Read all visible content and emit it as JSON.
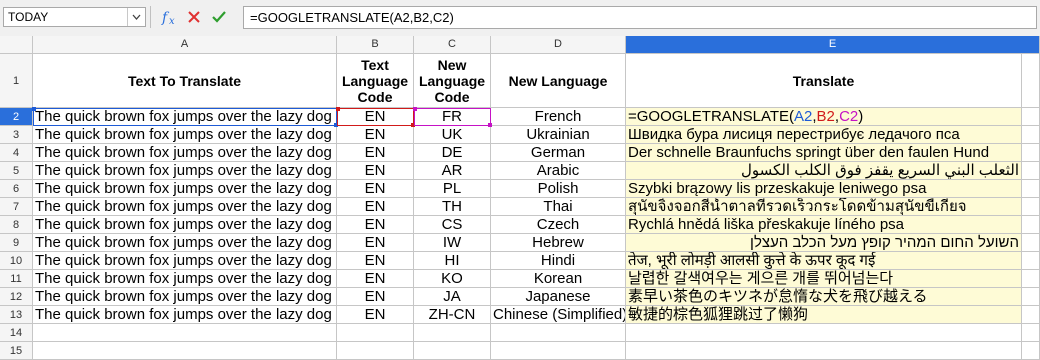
{
  "formula_bar": {
    "name_box_value": "TODAY",
    "formula_text": "=GOOGLETRANSLATE(A2,B2,C2)",
    "icons": [
      "function-wizard-icon",
      "cancel-icon",
      "accept-icon"
    ]
  },
  "columns": [
    "A",
    "B",
    "C",
    "D",
    "E"
  ],
  "header_row": {
    "A": "Text To Translate",
    "B": "Text Language Code",
    "C": "New Language Code",
    "D": "New Language",
    "E": "Translate"
  },
  "formula_cell": {
    "prefix": "=GOOGLETRANSLATE(",
    "arg1": "A2",
    "sep1": ",",
    "arg2": "B2",
    "sep2": ",",
    "arg3": "C2",
    "suffix": ")"
  },
  "rows": [
    {
      "num": "2",
      "A": "The quick brown fox jumps over the lazy dog",
      "B": "EN",
      "C": "FR",
      "D": "French",
      "E": ""
    },
    {
      "num": "3",
      "A": "The quick brown fox jumps over the lazy dog",
      "B": "EN",
      "C": "UK",
      "D": "Ukrainian",
      "E": "Швидка бура лисиця перестрибує ледачого пса"
    },
    {
      "num": "4",
      "A": "The quick brown fox jumps over the lazy dog",
      "B": "EN",
      "C": "DE",
      "D": "German",
      "E": "Der schnelle Braunfuchs springt über den faulen Hund"
    },
    {
      "num": "5",
      "A": "The quick brown fox jumps over the lazy dog",
      "B": "EN",
      "C": "AR",
      "D": "Arabic",
      "E": "الثعلب البني السريع يقفز فوق الكلب الكسول"
    },
    {
      "num": "6",
      "A": "The quick brown fox jumps over the lazy dog",
      "B": "EN",
      "C": "PL",
      "D": "Polish",
      "E": "Szybki brązowy lis przeskakuje leniwego psa"
    },
    {
      "num": "7",
      "A": "The quick brown fox jumps over the lazy dog",
      "B": "EN",
      "C": "TH",
      "D": "Thai",
      "E": "สุนัขจิ้งจอกสีน้ำตาลที่รวดเร็วกระโดดข้ามสุนัขขี้เกียจ"
    },
    {
      "num": "8",
      "A": "The quick brown fox jumps over the lazy dog",
      "B": "EN",
      "C": "CS",
      "D": "Czech",
      "E": "Rychlá hnědá liška přeskakuje líného psa"
    },
    {
      "num": "9",
      "A": "The quick brown fox jumps over the lazy dog",
      "B": "EN",
      "C": "IW",
      "D": "Hebrew",
      "E": "השועל החום המהיר קופץ מעל הכלב העצלן"
    },
    {
      "num": "10",
      "A": "The quick brown fox jumps over the lazy dog",
      "B": "EN",
      "C": "HI",
      "D": "Hindi",
      "E": "तेज, भूरी लोमड़ी आलसी कुत्ते के ऊपर कूद गई"
    },
    {
      "num": "11",
      "A": "The quick brown fox jumps over the lazy dog",
      "B": "EN",
      "C": "KO",
      "D": "Korean",
      "E": "날렵한 갈색여우는 게으른 개를 뛰어넘는다"
    },
    {
      "num": "12",
      "A": "The quick brown fox jumps over the lazy dog",
      "B": "EN",
      "C": "JA",
      "D": "Japanese",
      "E": "素早い茶色のキツネが怠惰な犬を飛び越える"
    },
    {
      "num": "13",
      "A": "The quick brown fox jumps over the lazy dog",
      "B": "EN",
      "C": "ZH-CN",
      "D": "Chinese (Simplified)",
      "E": "敏捷的棕色狐狸跳过了懒狗"
    }
  ],
  "empty_rows": [
    "14",
    "15"
  ],
  "header_row_num": "1",
  "colors": {
    "accent": "#2a6fdb",
    "translate_fill": "#fefbd6",
    "ref_blue": "#1e5bd6",
    "ref_red": "#d11a1a",
    "ref_magenta": "#c512c5"
  }
}
